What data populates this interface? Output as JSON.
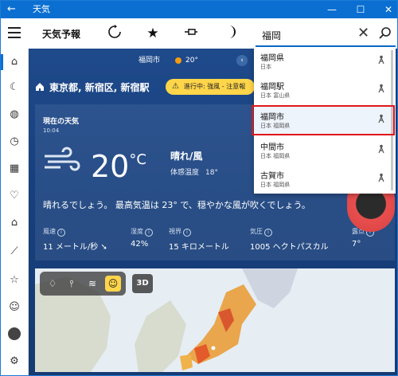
{
  "titlebar": {
    "back_glyph": "←",
    "title": "天気",
    "controls": {
      "minimize": "—",
      "maximize": "☐",
      "close": "✕"
    }
  },
  "toolbar": {
    "app_title": "天気予報",
    "icons": [
      "refresh-icon",
      "star-icon",
      "pin-icon",
      "moon-icon"
    ]
  },
  "search": {
    "value": "福岡",
    "clear_glyph": "✕"
  },
  "suggestions": [
    {
      "name": "福岡県",
      "sub": "日本"
    },
    {
      "name": "福岡駅",
      "sub": "日本 富山県"
    },
    {
      "name": "福岡市",
      "sub": "日本 福岡県"
    },
    {
      "name": "中間市",
      "sub": "日本 福岡県"
    },
    {
      "name": "古賀市",
      "sub": "日本 福岡県"
    }
  ],
  "summary": {
    "city": "福岡市",
    "temp": "20°"
  },
  "location": {
    "name": "東京都, 新宿区, 新宿駅"
  },
  "alert": {
    "icon": "⚠",
    "text": "進行中: 強風 - 注意報"
  },
  "current": {
    "heading": "現在の天気",
    "time": "10:04",
    "temp": "20",
    "unit": "°C",
    "condition": "晴れ/風",
    "feels_label": "体感温度",
    "feels_value": "18°",
    "description": "晴れるでしょう。 最高気温は 23° で、穏やかな風が吹くでしょう。"
  },
  "stats": [
    {
      "label": "風速",
      "value": "11 メートル/秒 ➘"
    },
    {
      "label": "湿度",
      "value": "42%"
    },
    {
      "label": "視界",
      "value": "15 キロメートル"
    },
    {
      "label": "気圧",
      "value": "1005 ヘクトパスカル"
    },
    {
      "label": "露点",
      "value": "7°"
    }
  ],
  "map_controls": {
    "items": [
      "drop-icon",
      "thermometer-icon",
      "wind-icon",
      "smile-icon"
    ],
    "three_d": "3D"
  },
  "leftnav": [
    "home-icon",
    "forecast-icon",
    "maps-icon",
    "history-icon",
    "calendar-icon",
    "favorites-icon",
    "news-icon",
    "chart-icon",
    "list-icon",
    "smile-icon",
    "profile-icon",
    "settings-icon"
  ],
  "colors": {
    "accent": "#0a6fd1",
    "alert": "#ffd54a",
    "highlight": "#e0161b",
    "main_bg": "#1a3a6e"
  }
}
